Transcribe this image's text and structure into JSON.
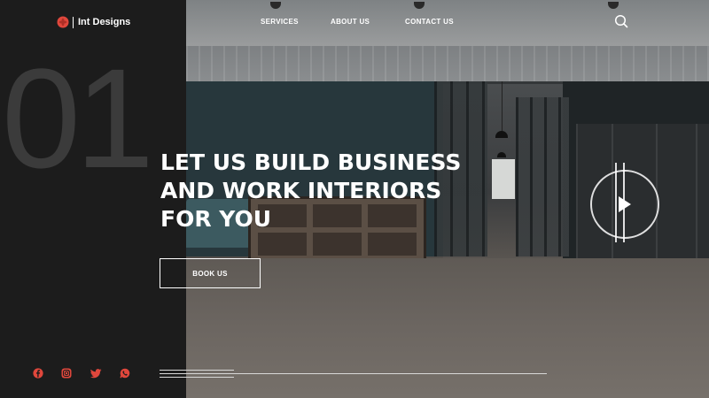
{
  "brand": {
    "name": "Int Designs",
    "accent_color": "#e0473c",
    "logo_icon": "flower-logo-icon"
  },
  "nav": {
    "items": [
      {
        "label": "SERVICES"
      },
      {
        "label": "ABOUT US"
      },
      {
        "label": "CONTACT US"
      }
    ],
    "search_icon": "search-icon"
  },
  "hero": {
    "slide_number": "01",
    "title_lines": [
      "LET US BUILD BUSINESS",
      "AND WORK INTERIORS",
      "FOR YOU"
    ],
    "cta_label": "BOOK US",
    "play_icon": "play-icon"
  },
  "social": [
    {
      "icon": "facebook-icon",
      "color": "#e0473c"
    },
    {
      "icon": "instagram-icon",
      "color": "#e0473c"
    },
    {
      "icon": "twitter-icon",
      "color": "#e0473c"
    },
    {
      "icon": "whatsapp-icon",
      "color": "#e0473c"
    }
  ]
}
